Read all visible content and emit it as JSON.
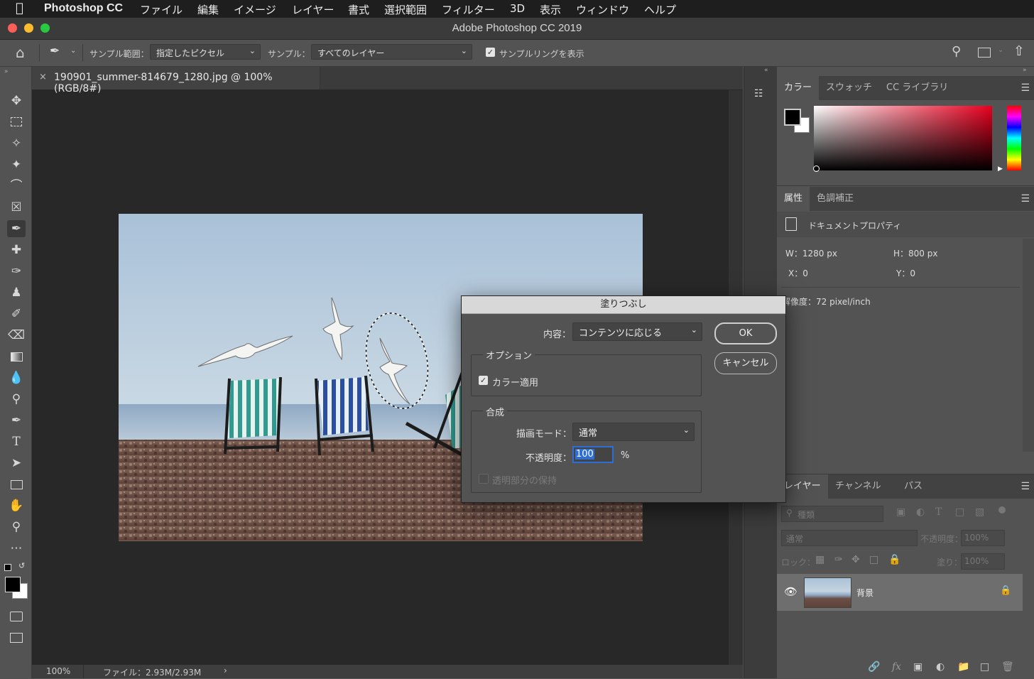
{
  "menubar": {
    "app_name": "Photoshop CC",
    "items": [
      "ファイル",
      "編集",
      "イメージ",
      "レイヤー",
      "書式",
      "選択範囲",
      "フィルター",
      "3D",
      "表示",
      "ウィンドウ",
      "ヘルプ"
    ]
  },
  "window": {
    "title": "Adobe Photoshop CC 2019"
  },
  "options_bar": {
    "sample_range_label": "サンプル範囲：",
    "sample_range_value": "指定したピクセル",
    "sample_label": "サンプル：",
    "sample_value": "すべてのレイヤー",
    "show_ring_label": "サンプルリングを表示",
    "show_ring_checked": true
  },
  "document": {
    "tab_title": "190901_summer-814679_1280.jpg @ 100% (RGB/8#)",
    "zoom": "100%",
    "file_info": "ファイル：2.93M/2.93M"
  },
  "color_panel": {
    "tabs": [
      "カラー",
      "スウォッチ",
      "CC ライブラリ"
    ],
    "hue_color": "#ff0000"
  },
  "properties_panel": {
    "tabs": [
      "属性",
      "色調補正"
    ],
    "section_title": "ドキュメントプロパティ",
    "width": "W：1280 px",
    "height": "H：800 px",
    "x": "X：0",
    "y": "Y：0",
    "resolution": "解像度：72 pixel/inch"
  },
  "layers_panel": {
    "tabs": [
      "レイヤー",
      "チャンネル",
      "パス"
    ],
    "filter_placeholder": "種類",
    "blend_mode": "通常",
    "opacity_label": "不透明度：",
    "opacity_value": "100%",
    "lock_label": "ロック：",
    "fill_label": "塗り：",
    "fill_value": "100%",
    "layer_name": "背景"
  },
  "fill_dialog": {
    "title": "塗りつぶし",
    "contents_label": "内容：",
    "contents_value": "コンテンツに応じる",
    "options_title": "オプション",
    "color_adapt_label": "カラー適用",
    "color_adapt_checked": true,
    "blending_title": "合成",
    "mode_label": "描画モード：",
    "mode_value": "通常",
    "opacity_label": "不透明度：",
    "opacity_value": "100",
    "opacity_unit": "%",
    "preserve_label": "透明部分の保持",
    "preserve_checked": false,
    "ok_label": "OK",
    "cancel_label": "キャンセル"
  }
}
